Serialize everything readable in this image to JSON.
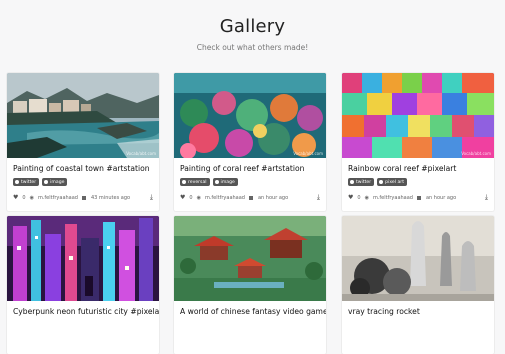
{
  "page": {
    "title": "Gallery",
    "subtitle": "Check out what others made!"
  },
  "watermark": "Vocab/abt.com",
  "cards": [
    {
      "title": "Painting of coastal town #artstation",
      "tags": [
        "twitter",
        "image"
      ],
      "likes": "0",
      "user": "m.feltfryaahaad",
      "time": "43 minutes ago"
    },
    {
      "title": "Painting of coral reef #artstation",
      "tags": [
        "reversal",
        "image"
      ],
      "likes": "0",
      "user": "m.feltfryaahaad",
      "time": "an hour ago"
    },
    {
      "title": "Rainbow coral reef #pixelart",
      "tags": [
        "twitter",
        "pixel art"
      ],
      "likes": "0",
      "user": "m.feltfryaahaad",
      "time": "an hour ago"
    },
    {
      "title": "Cyberpunk neon futuristic city #pixelart",
      "tags": [],
      "likes": "",
      "user": "",
      "time": ""
    },
    {
      "title": "A world of chinese fantasy video game",
      "tags": [],
      "likes": "",
      "user": "",
      "time": ""
    },
    {
      "title": "vray tracing rocket",
      "tags": [],
      "likes": "",
      "user": "",
      "time": ""
    }
  ]
}
